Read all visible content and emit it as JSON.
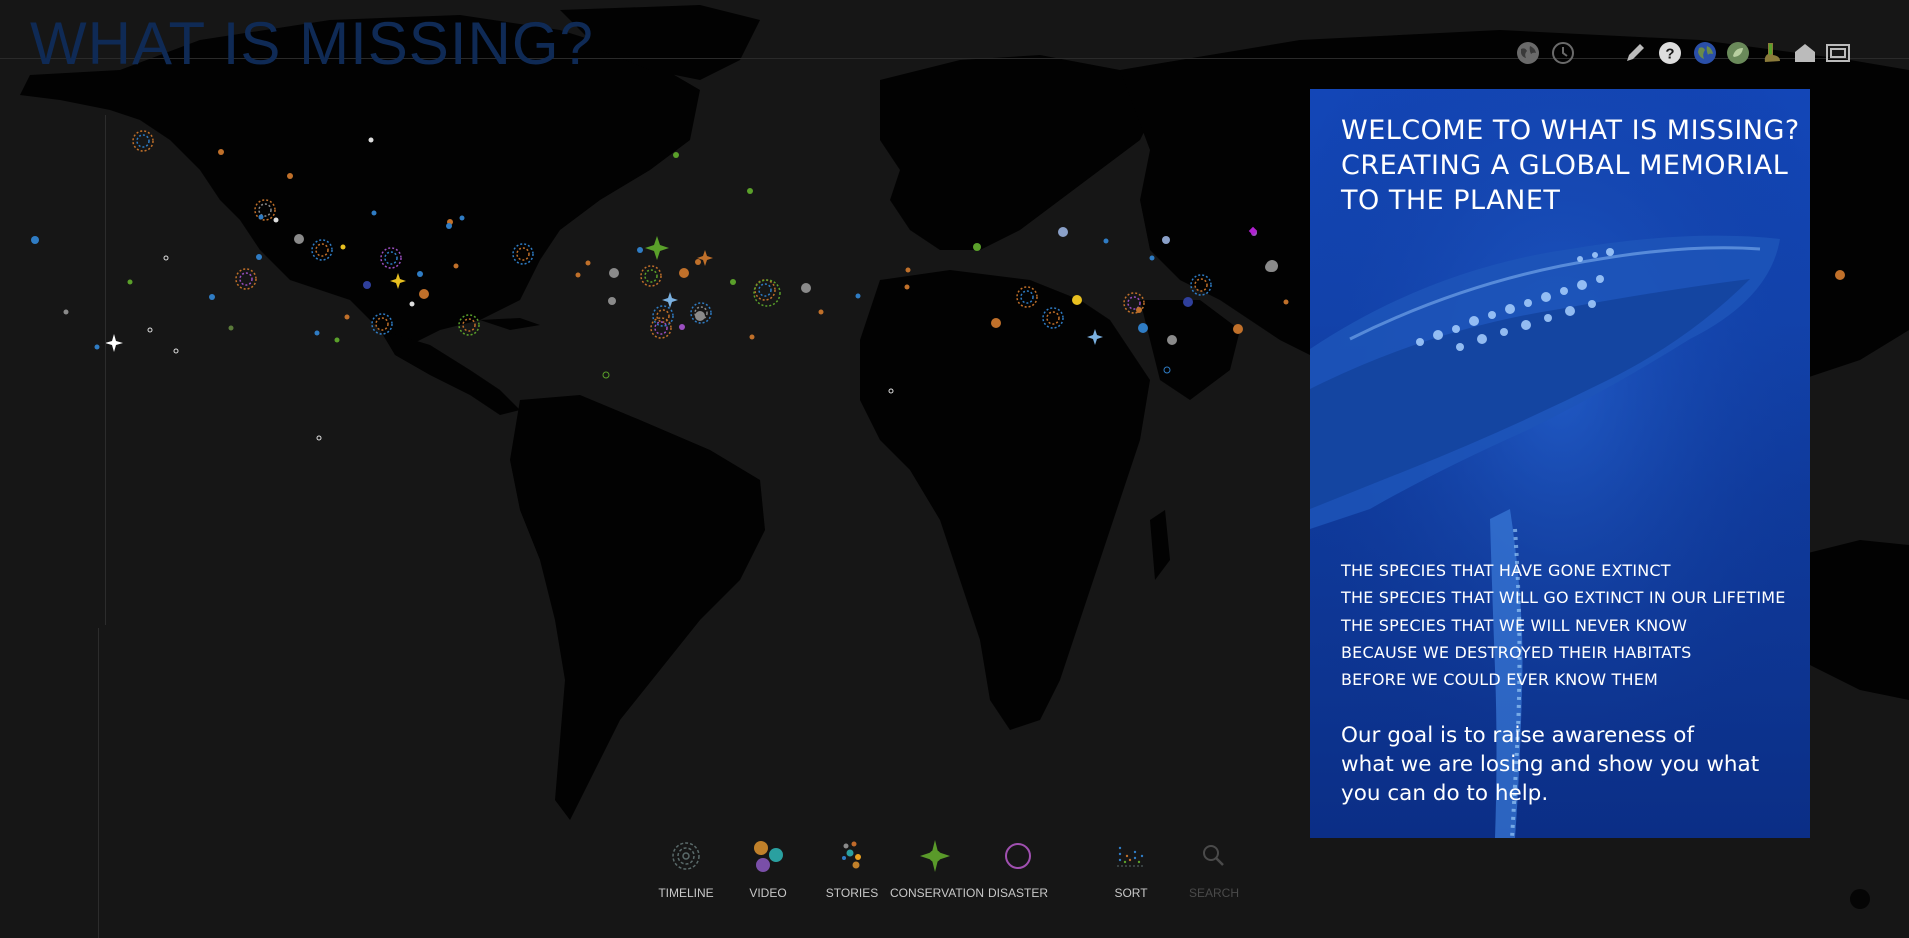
{
  "app": {
    "title": "WHAT IS MISSING?"
  },
  "toolbar": {
    "icons": [
      "globe-icon",
      "clock-icon",
      "pencil-icon",
      "help-icon",
      "earth-icon",
      "leaf-globe-icon",
      "foot-icon",
      "home-icon",
      "fullscreen-icon"
    ]
  },
  "welcome_panel": {
    "heading_lines": [
      "WELCOME TO WHAT IS MISSING?",
      "CREATING A GLOBAL MEMORIAL",
      "TO THE PLANET"
    ],
    "species_lines": [
      "THE SPECIES THAT HAVE GONE EXTINCT",
      "THE SPECIES THAT WILL GO EXTINCT IN OUR LIFETIME",
      "THE SPECIES THAT WE WILL NEVER KNOW",
      "BECAUSE WE DESTROYED THEIR HABITATS",
      "BEFORE WE COULD EVER KNOW THEM"
    ],
    "goal_lines": [
      "Our goal is to raise awareness of",
      "what we are losing and show you what",
      "you can do to help."
    ],
    "background": "humpback-whale-photo"
  },
  "nav": {
    "items": [
      {
        "label": "TIMELINE",
        "icon": "timeline-spiral-icon",
        "enabled": true
      },
      {
        "label": "VIDEO",
        "icon": "video-dots-icon",
        "enabled": true
      },
      {
        "label": "STORIES",
        "icon": "stories-dots-icon",
        "enabled": true
      },
      {
        "label": "CONSERVATION",
        "icon": "conservation-star-icon",
        "enabled": true
      },
      {
        "label": "DISASTER",
        "icon": "disaster-circle-icon",
        "enabled": true
      },
      {
        "label": "SORT",
        "icon": "sort-icon",
        "enabled": true
      },
      {
        "label": "SEARCH",
        "icon": "search-icon",
        "enabled": false
      }
    ]
  },
  "colors": {
    "background": "#161616",
    "land": "#020202",
    "title": "#0f2a55",
    "panel_blue": "#1346b7",
    "marker_orange": "#c0702a",
    "marker_green": "#5aa02a",
    "marker_blue": "#2f7cc4",
    "marker_purple": "#9b4fc0",
    "marker_gray": "#8a8a8a",
    "marker_yellow": "#e8c020"
  }
}
